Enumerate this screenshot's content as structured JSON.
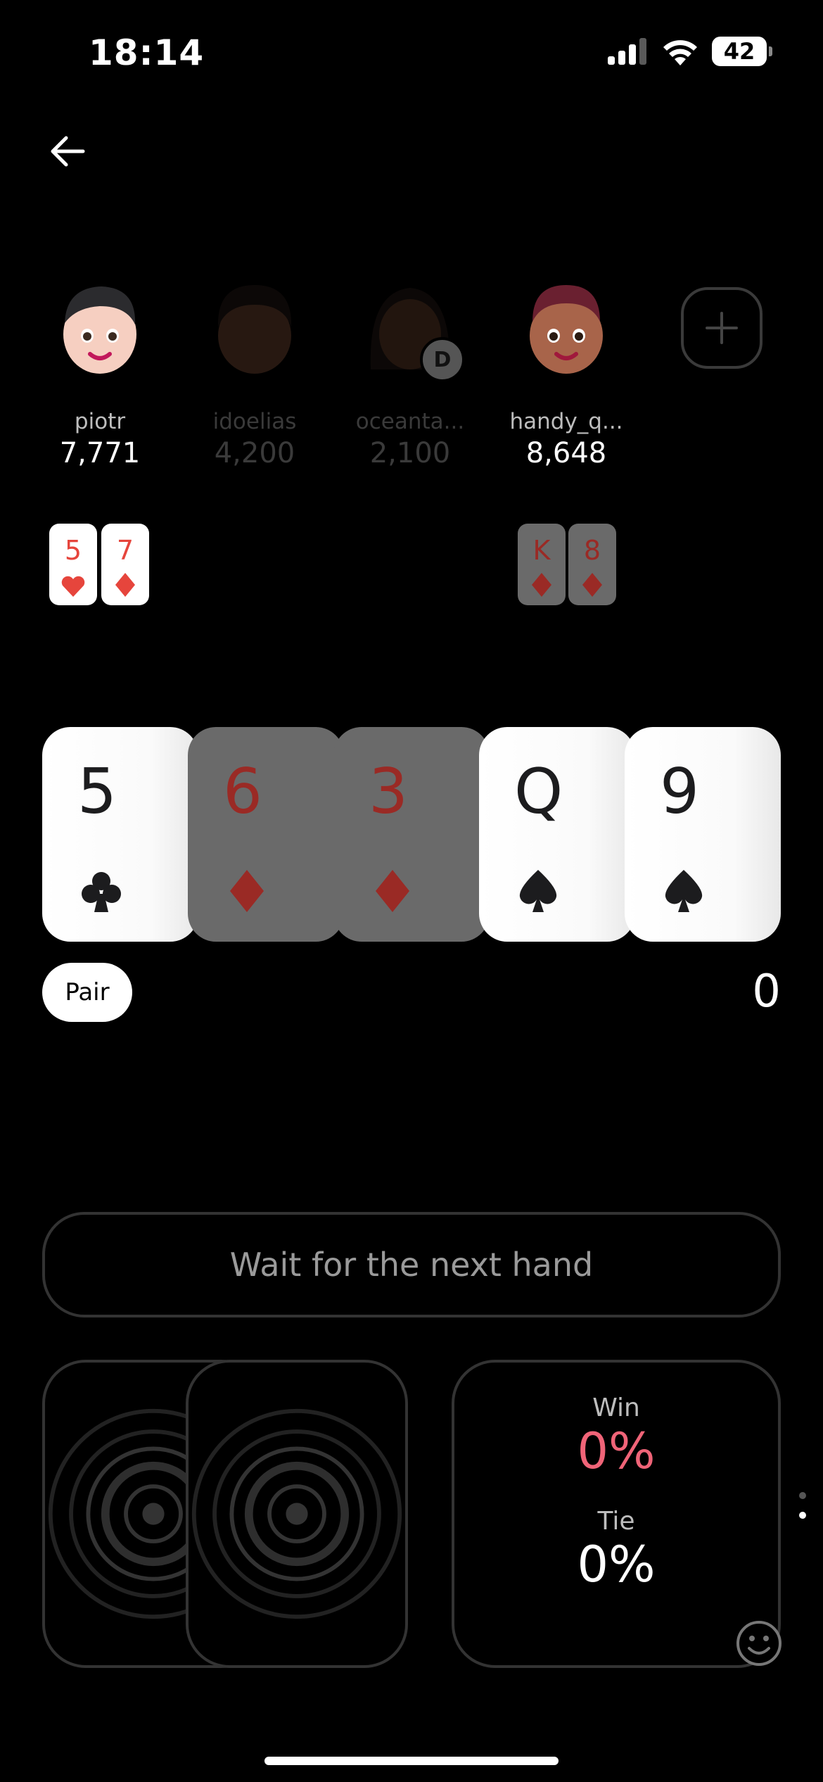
{
  "status_bar": {
    "time": "18:14",
    "battery": "42"
  },
  "players": [
    {
      "name": "piotr",
      "chips": "7,771",
      "active": true
    },
    {
      "name": "idoelias",
      "chips": "4,200",
      "active": false
    },
    {
      "name": "oceanta...",
      "chips": "2,100",
      "active": false,
      "dealer": "D"
    },
    {
      "name": "handy_q...",
      "chips": "8,648",
      "active": true
    }
  ],
  "my_cards": [
    {
      "rank": "5",
      "suit": "hearts"
    },
    {
      "rank": "7",
      "suit": "diamonds"
    }
  ],
  "opponent_cards": [
    {
      "rank": "K",
      "suit": "diamonds"
    },
    {
      "rank": "8",
      "suit": "diamonds"
    }
  ],
  "board": [
    {
      "rank": "5",
      "suit": "clubs",
      "highlight": true
    },
    {
      "rank": "6",
      "suit": "diamonds",
      "highlight": false
    },
    {
      "rank": "3",
      "suit": "diamonds",
      "highlight": false
    },
    {
      "rank": "Q",
      "suit": "spades",
      "highlight": true
    },
    {
      "rank": "9",
      "suit": "spades",
      "highlight": true
    }
  ],
  "hand_label": "Pair",
  "pot": "0",
  "action_text": "Wait for the next hand",
  "odds": {
    "win_label": "Win",
    "win_value": "0%",
    "tie_label": "Tie",
    "tie_value": "0%"
  },
  "colors": {
    "background": "#000000",
    "win_color": "#f06478",
    "card_red": "#e6453c"
  }
}
